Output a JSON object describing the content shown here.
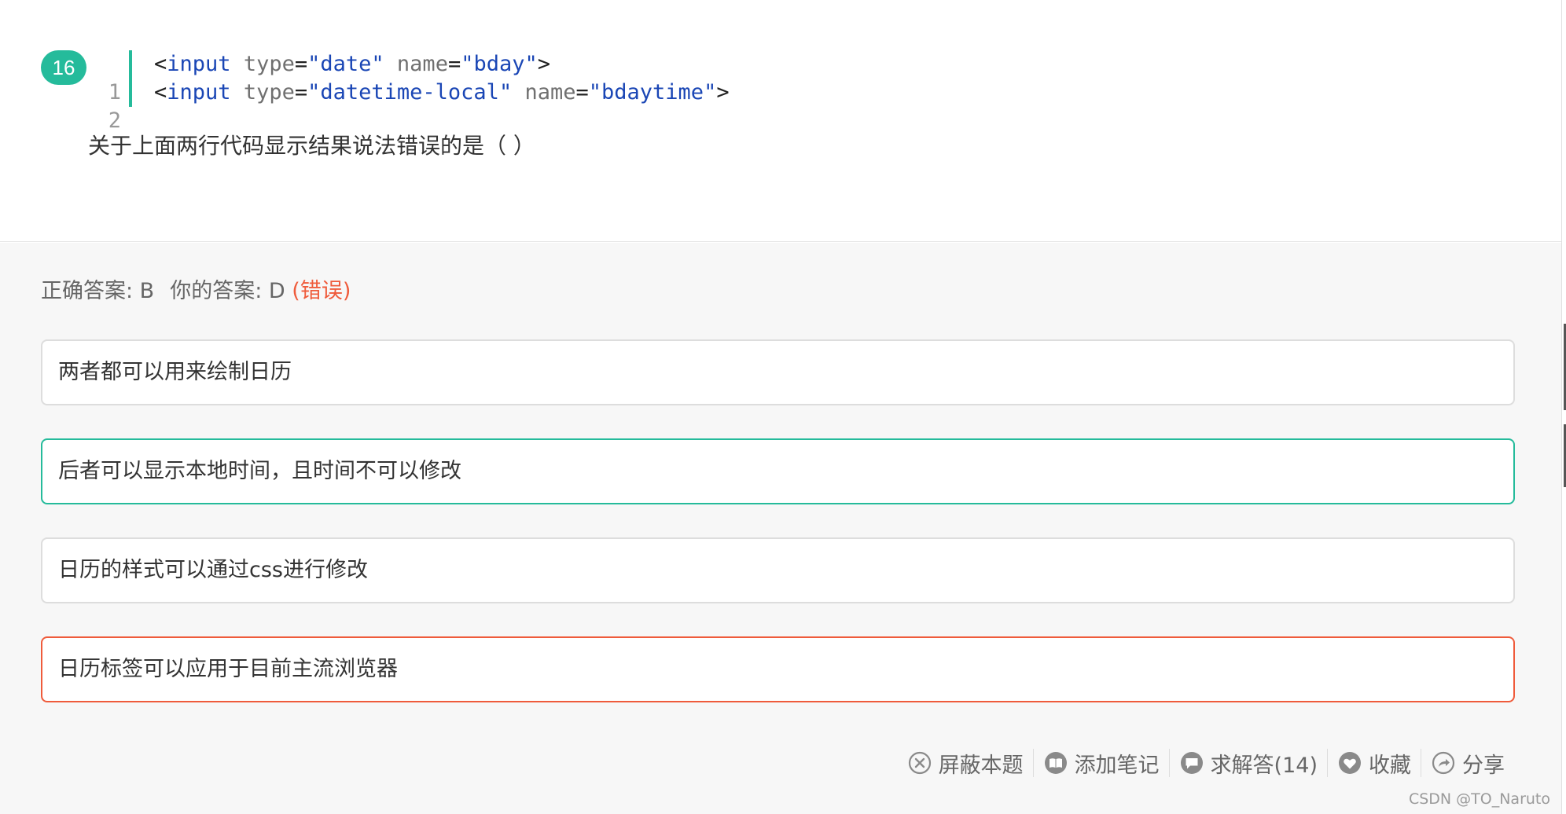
{
  "question": {
    "number": "16",
    "code_lines": [
      {
        "num": "1",
        "open": "<",
        "tag": "input",
        "attr1": "type",
        "eq1": "=",
        "val1": "\"date\"",
        "attr2": "name",
        "eq2": "=",
        "val2": "\"bday\"",
        "close": ">"
      },
      {
        "num": "2",
        "open": "<",
        "tag": "input",
        "attr1": "type",
        "eq1": "=",
        "val1": "\"datetime-local\"",
        "attr2": "name",
        "eq2": "=",
        "val2": "\"bdaytime\"",
        "close": ">"
      }
    ],
    "text": "关于上面两行代码显示结果说法错误的是（     ）"
  },
  "result": {
    "correct_label": "正确答案: B",
    "your_label": "你的答案: D",
    "status": "(错误)"
  },
  "options": [
    {
      "text": "两者都可以用来绘制日历",
      "state": "normal"
    },
    {
      "text": "后者可以显示本地时间，且时间不可以修改",
      "state": "correct"
    },
    {
      "text": "日历的样式可以通过css进行修改",
      "state": "normal"
    },
    {
      "text": "日历标签可以应用于目前主流浏览器",
      "state": "wrong"
    }
  ],
  "toolbar": {
    "block_label": "屏蔽本题",
    "note_label": "添加笔记",
    "ask_label": "求解答(14)",
    "fav_label": "收藏",
    "share_label": "分享"
  },
  "icons": {
    "block": "close-circle-icon",
    "note": "book-icon",
    "ask": "chat-bubble-icon",
    "fav": "heart-icon",
    "share": "share-icon"
  },
  "colors": {
    "accent": "#25bb9b",
    "error": "#ef5b3b",
    "code_keyword": "#1a46b5"
  },
  "watermark": "CSDN @TO_Naruto"
}
